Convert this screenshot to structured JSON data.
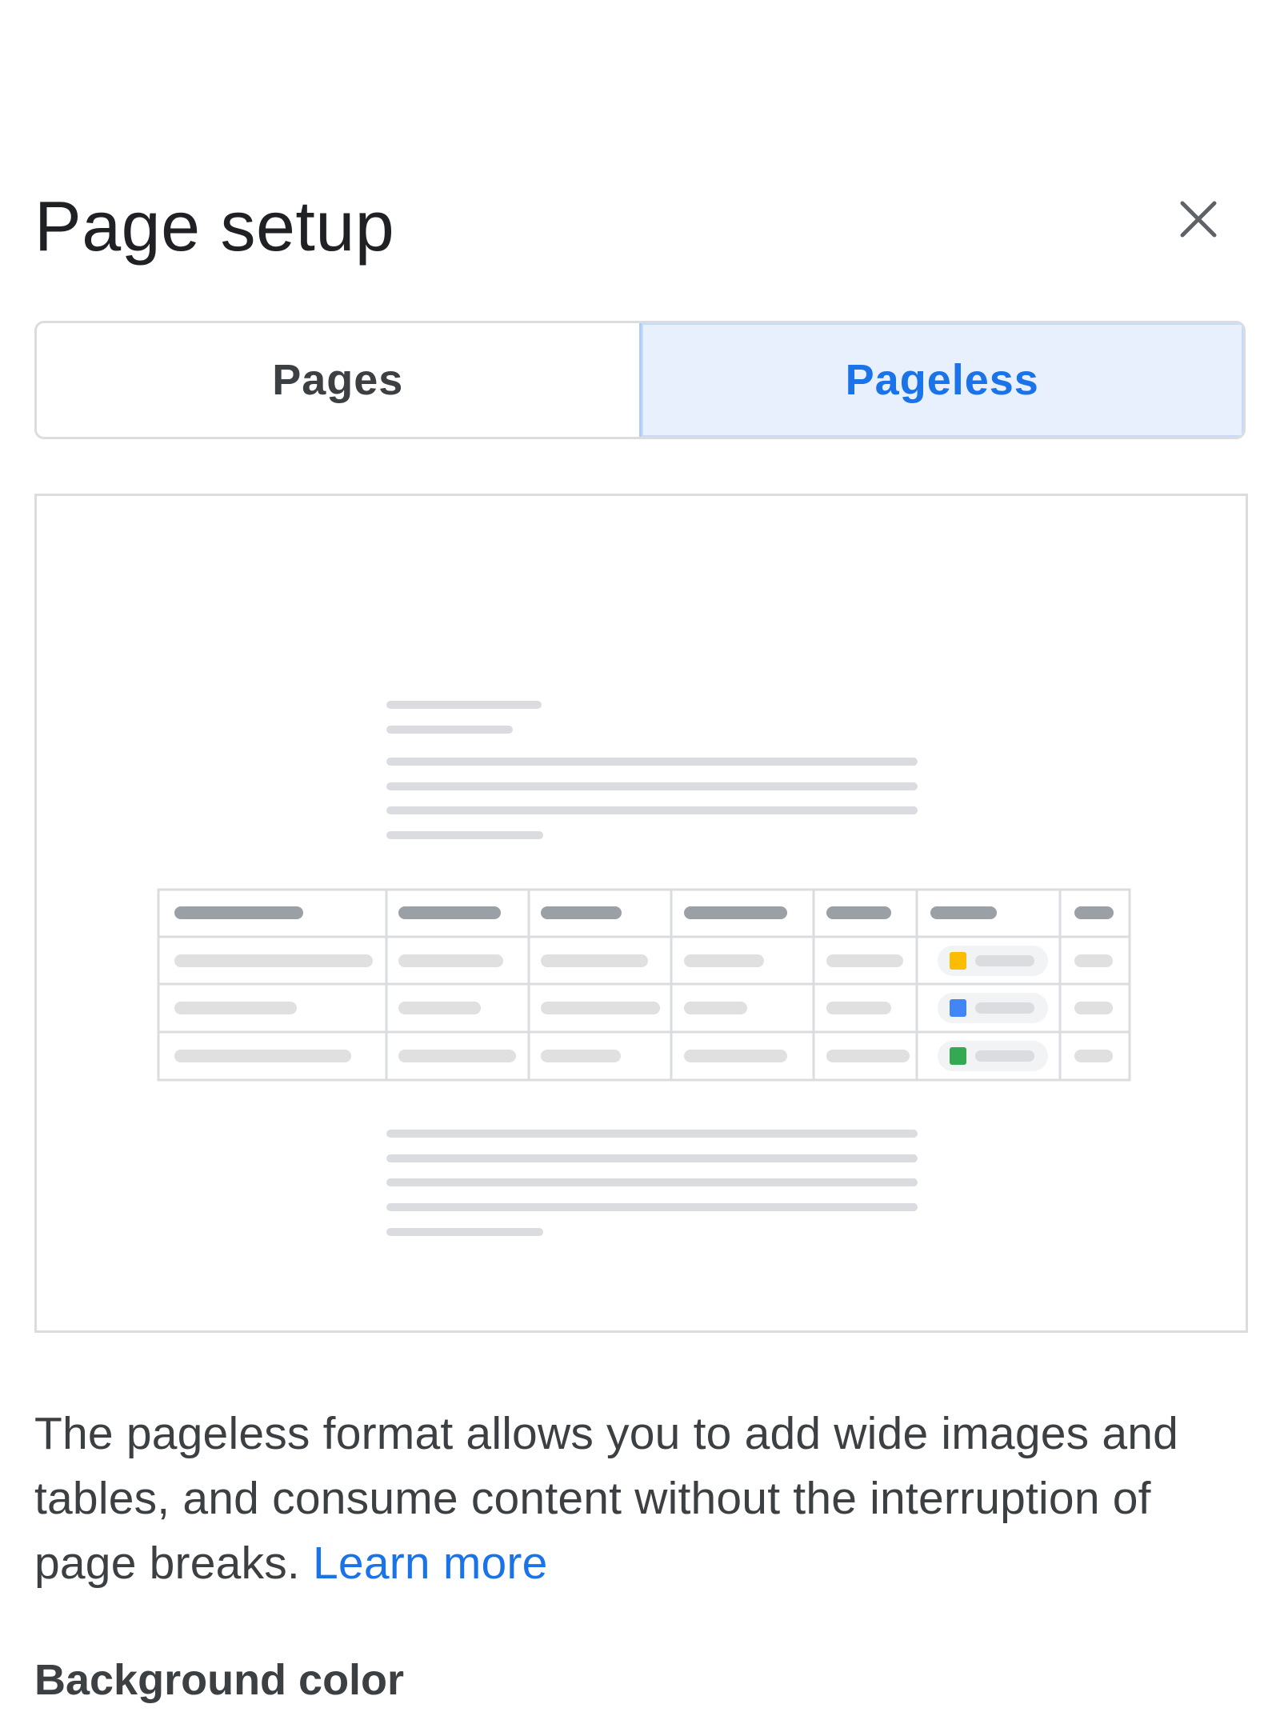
{
  "dialog": {
    "title": "Page setup",
    "close_icon": "close-icon"
  },
  "format_toggle": {
    "options": [
      {
        "label": "Pages",
        "selected": false
      },
      {
        "label": "Pageless",
        "selected": true
      }
    ]
  },
  "preview": {
    "illustration": "pageless-document-illustration",
    "status_colors": [
      "#fbbc04",
      "#4285f4",
      "#34a853"
    ]
  },
  "description": {
    "text": "The pageless format allows you to add wide images and tables, and consume content without the interruption of page breaks.",
    "link_label": "Learn more"
  },
  "background": {
    "label": "Background color"
  },
  "colors": {
    "accent": "#1a73e8",
    "selected_bg": "#e8f0fe",
    "border": "#dadce0",
    "text": "#202124"
  }
}
